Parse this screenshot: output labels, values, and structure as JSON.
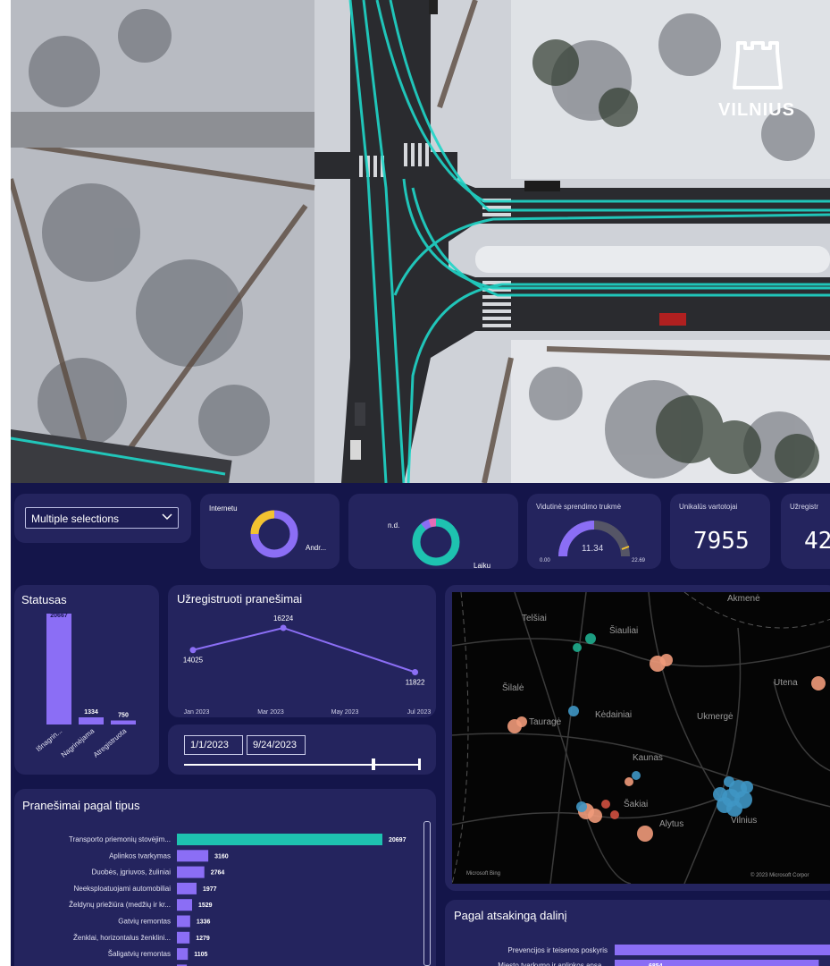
{
  "hero": {
    "brand": "VILNIUS",
    "icon": "castle-tower-icon",
    "description_colors": {
      "road": "#2c2c2e",
      "snow": "#e6e8ec",
      "trail": "#1fd6c8"
    }
  },
  "filters": {
    "selector_value": "Multiple selections",
    "date_from": "1/1/2023",
    "date_to": "9/24/2023"
  },
  "kpi": {
    "channel_donut": {
      "label_top": "Internetu",
      "label_right": "Andr..."
    },
    "time_donut": {
      "label_top": "n.d.",
      "label_right": "Laiku"
    },
    "gauge": {
      "title": "Vidutinė sprendimo trukmė",
      "value": "11.34",
      "min": "0.00",
      "max": "22.69",
      "fraction": 0.5
    },
    "unique_users": {
      "title": "Unikalūs vartotojai",
      "value": "7955"
    },
    "registered": {
      "title": "Užregistr",
      "value": "42"
    }
  },
  "status_chart": {
    "title": "Statusas",
    "chart_data": {
      "type": "bar",
      "categories": [
        "Išnagrin...",
        "Nagrinėjama",
        "Atregistruota"
      ],
      "values": [
        20667,
        1334,
        750
      ]
    }
  },
  "registered_chart": {
    "title": "Užregistruoti pranešimai",
    "chart_data": {
      "type": "line",
      "x": [
        "Jan 2023",
        "Mar 2023",
        "May 2023",
        "Jul 2023"
      ],
      "point_x": [
        0,
        2.4,
        5.9
      ],
      "values": [
        14025,
        16224,
        11822
      ],
      "ylim": [
        10000,
        18000
      ]
    }
  },
  "types_chart": {
    "title": "Pranešimai pagal tipus",
    "chart_data": {
      "type": "bar",
      "categories": [
        "Transporto priemonių stovėjim...",
        "Aplinkos tvarkymas",
        "Duobės, įgriuvos, žuliniai",
        "Neeksploatuojami automobiliai",
        "Želdynų priežiūra (medžių ir kr...",
        "Gatvių remontas",
        "Ženklai, horizontalus ženklini...",
        "Šaligatvių remontas",
        ""
      ],
      "values": [
        20697,
        3160,
        2764,
        1977,
        1529,
        1336,
        1279,
        1105,
        1000
      ],
      "labels": [
        "20697",
        "3160",
        "2764",
        "1977",
        "1529",
        "1336",
        "1279",
        "1105",
        ""
      ]
    }
  },
  "map": {
    "places": [
      "Akmenė",
      "Telšiai",
      "Šiauliai",
      "Šilalė",
      "Kėdainiai",
      "Ukmergė",
      "Utena",
      "Tauragė",
      "Kaunas",
      "Alytus",
      "Šakiai",
      "Vilnius"
    ],
    "footer_left": "Microsoft Bing",
    "footer_right": "© 2023 Microsoft Corpor",
    "colors": {
      "blue": "#3f96c4",
      "orange": "#f09a7a",
      "teal": "#1fae8f",
      "red": "#d05040"
    }
  },
  "dept_chart": {
    "title": "Pagal atsakingą dalinį",
    "chart_data": {
      "type": "bar",
      "categories": [
        "Prevencijos ir teisenos poskyris",
        "Miesto tvarkymo ir aplinkos apsa..."
      ],
      "values": [
        9000,
        6854
      ],
      "labels": [
        "",
        "6854"
      ]
    }
  },
  "colors": {
    "purple": "#8b6ef5",
    "teal": "#1ec2b0",
    "yellow": "#f2c230",
    "card": "#24245e",
    "bg": "#14154a"
  }
}
